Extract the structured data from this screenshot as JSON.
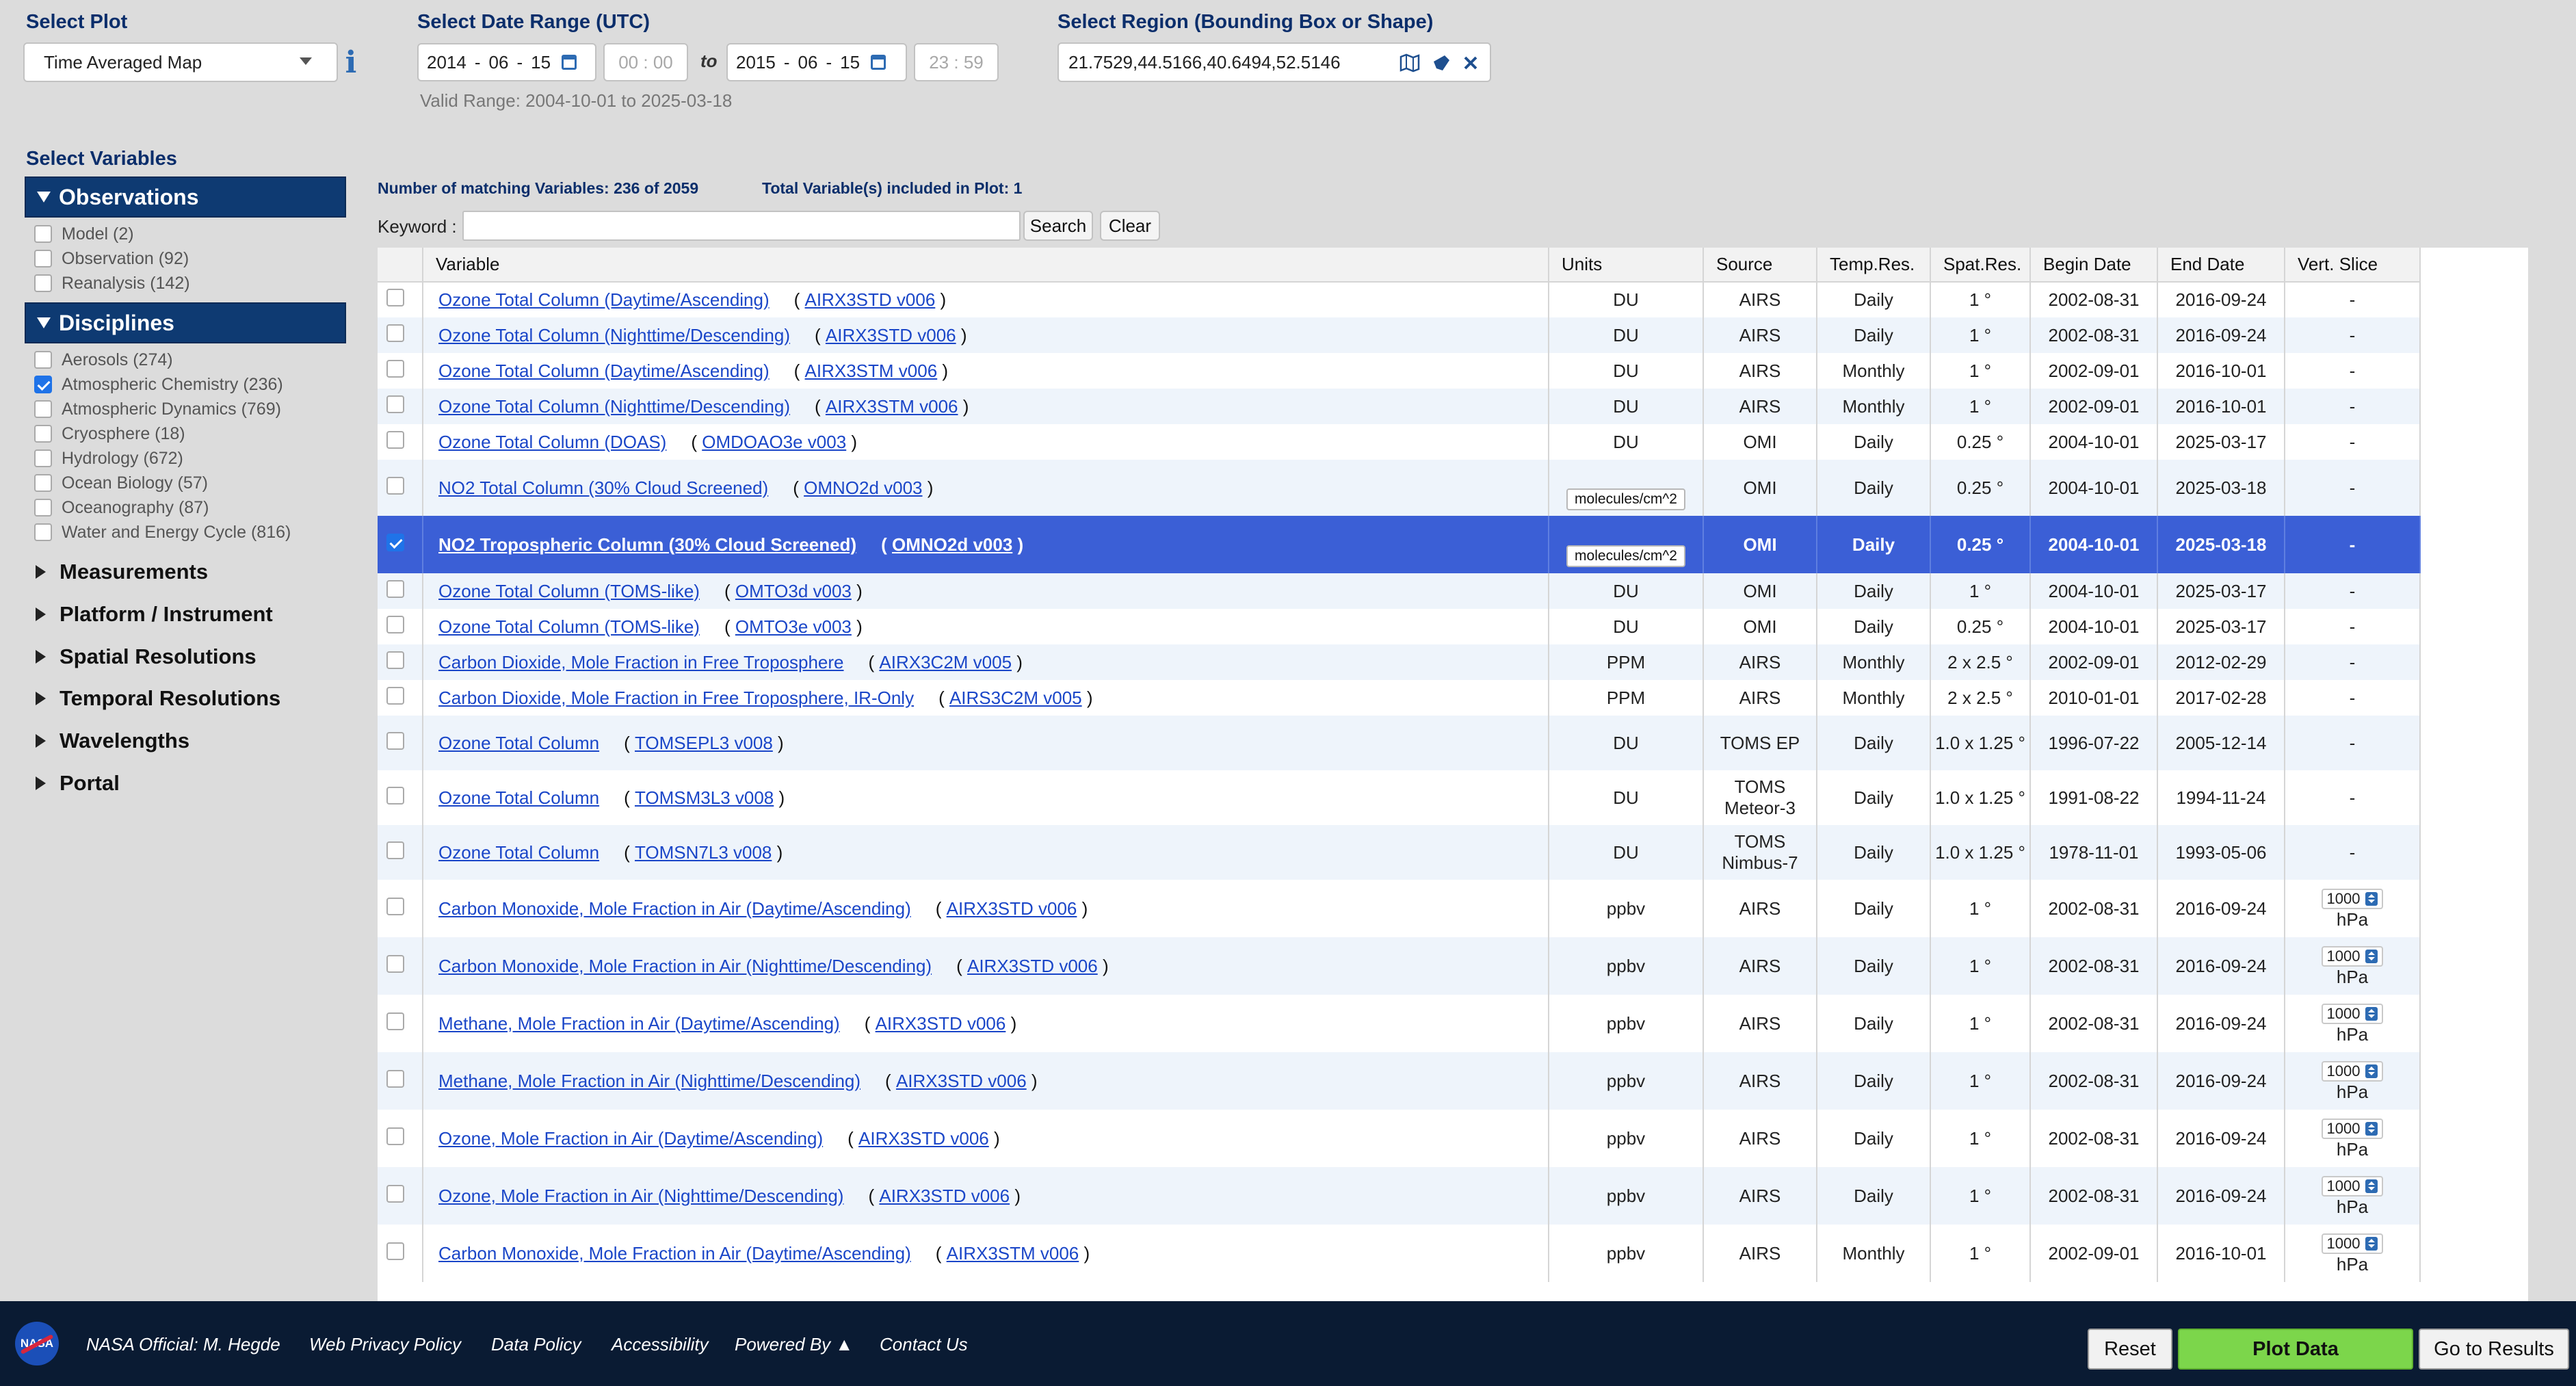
{
  "header": {
    "select_plot_label": "Select Plot",
    "plot_type": "Time Averaged Map",
    "info_glyph": "i",
    "date_range_label": "Select Date Range (UTC)",
    "start_year": "2014",
    "start_month": "06",
    "start_day": "15",
    "start_hour": "00",
    "start_min": "00",
    "to_label": "to",
    "end_year": "2015",
    "end_month": "06",
    "end_day": "15",
    "end_hour": "23",
    "end_min": "59",
    "valid_range": "Valid Range: 2004-10-01 to 2025-03-18",
    "region_label": "Select Region (Bounding Box or Shape)",
    "region_value": "21.7529,44.5166,40.6494,52.5146",
    "sep_dash": "-",
    "sep_colon": ":"
  },
  "sidebar": {
    "title": "Select Variables",
    "observations": {
      "label": "Observations",
      "items": [
        {
          "label": "Model (2)",
          "checked": false
        },
        {
          "label": "Observation (92)",
          "checked": false
        },
        {
          "label": "Reanalysis (142)",
          "checked": false
        }
      ]
    },
    "disciplines": {
      "label": "Disciplines",
      "items": [
        {
          "label": "Aerosols (274)",
          "checked": false
        },
        {
          "label": "Atmospheric Chemistry (236)",
          "checked": true
        },
        {
          "label": "Atmospheric Dynamics (769)",
          "checked": false
        },
        {
          "label": "Cryosphere (18)",
          "checked": false
        },
        {
          "label": "Hydrology (672)",
          "checked": false
        },
        {
          "label": "Ocean Biology (57)",
          "checked": false
        },
        {
          "label": "Oceanography (87)",
          "checked": false
        },
        {
          "label": "Water and Energy Cycle (816)",
          "checked": false
        }
      ]
    },
    "collapsed": [
      "Measurements",
      "Platform / Instrument",
      "Spatial Resolutions",
      "Temporal Resolutions",
      "Wavelengths",
      "Portal"
    ]
  },
  "results": {
    "matching": "Number of matching Variables: 236 of 2059",
    "included": "Total Variable(s) included in Plot: 1",
    "keyword_label": "Keyword :",
    "keyword_value": "",
    "search_label": "Search",
    "clear_label": "Clear",
    "columns": [
      "Variable",
      "Units",
      "Source",
      "Temp.Res.",
      "Spat.Res.",
      "Begin Date",
      "End Date",
      "Vert. Slice"
    ],
    "rows": [
      {
        "name": "Ozone Total Column (Daytime/Ascending)",
        "product": "AIRX3STD v006",
        "units": "DU",
        "source": "AIRS",
        "temp": "Daily",
        "spat": "1 °",
        "begin": "2002-08-31",
        "end": "2016-09-24",
        "vslice": "-",
        "checked": false
      },
      {
        "name": "Ozone Total Column (Nighttime/Descending)",
        "product": "AIRX3STD v006",
        "units": "DU",
        "source": "AIRS",
        "temp": "Daily",
        "spat": "1 °",
        "begin": "2002-08-31",
        "end": "2016-09-24",
        "vslice": "-",
        "checked": false
      },
      {
        "name": "Ozone Total Column (Daytime/Ascending)",
        "product": "AIRX3STM v006",
        "units": "DU",
        "source": "AIRS",
        "temp": "Monthly",
        "spat": "1 °",
        "begin": "2002-09-01",
        "end": "2016-10-01",
        "vslice": "-",
        "checked": false
      },
      {
        "name": "Ozone Total Column (Nighttime/Descending)",
        "product": "AIRX3STM v006",
        "units": "DU",
        "source": "AIRS",
        "temp": "Monthly",
        "spat": "1 °",
        "begin": "2002-09-01",
        "end": "2016-10-01",
        "vslice": "-",
        "checked": false
      },
      {
        "name": "Ozone Total Column (DOAS)",
        "product": "OMDOAO3e v003",
        "units": "DU",
        "source": "OMI",
        "temp": "Daily",
        "spat": "0.25 °",
        "begin": "2004-10-01",
        "end": "2025-03-17",
        "vslice": "-",
        "checked": false
      },
      {
        "name": "NO2 Total Column (30% Cloud Screened)",
        "product": "OMNO2d v003",
        "units": "molecules/cm^2",
        "source": "OMI",
        "temp": "Daily",
        "spat": "0.25 °",
        "begin": "2004-10-01",
        "end": "2025-03-18",
        "vslice": "-",
        "checked": false
      },
      {
        "name": "NO2 Tropospheric Column (30% Cloud Screened)",
        "product": "OMNO2d v003",
        "units": "molecules/cm^2",
        "source": "OMI",
        "temp": "Daily",
        "spat": "0.25 °",
        "begin": "2004-10-01",
        "end": "2025-03-18",
        "vslice": "-",
        "checked": true
      },
      {
        "name": "Ozone Total Column (TOMS-like)",
        "product": "OMTO3d v003",
        "units": "DU",
        "source": "OMI",
        "temp": "Daily",
        "spat": "1 °",
        "begin": "2004-10-01",
        "end": "2025-03-17",
        "vslice": "-",
        "checked": false
      },
      {
        "name": "Ozone Total Column (TOMS-like)",
        "product": "OMTO3e v003",
        "units": "DU",
        "source": "OMI",
        "temp": "Daily",
        "spat": "0.25 °",
        "begin": "2004-10-01",
        "end": "2025-03-17",
        "vslice": "-",
        "checked": false
      },
      {
        "name": "Carbon Dioxide, Mole Fraction in Free Troposphere",
        "product": "AIRX3C2M v005",
        "units": "PPM",
        "source": "AIRS",
        "temp": "Monthly",
        "spat": "2 x 2.5 °",
        "begin": "2002-09-01",
        "end": "2012-02-29",
        "vslice": "-",
        "checked": false
      },
      {
        "name": "Carbon Dioxide, Mole Fraction in Free Troposphere, IR-Only",
        "product": "AIRS3C2M v005",
        "units": "PPM",
        "source": "AIRS",
        "temp": "Monthly",
        "spat": "2 x 2.5 °",
        "begin": "2010-01-01",
        "end": "2017-02-28",
        "vslice": "-",
        "checked": false
      },
      {
        "name": "Ozone Total Column",
        "product": "TOMSEPL3 v008",
        "units": "DU",
        "source": "TOMS EP",
        "temp": "Daily",
        "spat": "1.0 x 1.25 °",
        "begin": "1996-07-22",
        "end": "2005-12-14",
        "vslice": "-",
        "checked": false
      },
      {
        "name": "Ozone Total Column",
        "product": "TOMSM3L3 v008",
        "units": "DU",
        "source": "TOMS Meteor-3",
        "temp": "Daily",
        "spat": "1.0 x 1.25 °",
        "begin": "1991-08-22",
        "end": "1994-11-24",
        "vslice": "-",
        "checked": false
      },
      {
        "name": "Ozone Total Column",
        "product": "TOMSN7L3 v008",
        "units": "DU",
        "source": "TOMS Nimbus-7",
        "temp": "Daily",
        "spat": "1.0 x 1.25 °",
        "begin": "1978-11-01",
        "end": "1993-05-06",
        "vslice": "-",
        "checked": false
      },
      {
        "name": "Carbon Monoxide, Mole Fraction in Air (Daytime/Ascending)",
        "product": "AIRX3STD v006",
        "units": "ppbv",
        "source": "AIRS",
        "temp": "Daily",
        "spat": "1 °",
        "begin": "2002-08-31",
        "end": "2016-09-24",
        "vslice": "1000",
        "vunit": "hPa",
        "checked": false
      },
      {
        "name": "Carbon Monoxide, Mole Fraction in Air (Nighttime/Descending)",
        "product": "AIRX3STD v006",
        "units": "ppbv",
        "source": "AIRS",
        "temp": "Daily",
        "spat": "1 °",
        "begin": "2002-08-31",
        "end": "2016-09-24",
        "vslice": "1000",
        "vunit": "hPa",
        "checked": false
      },
      {
        "name": "Methane, Mole Fraction in Air (Daytime/Ascending)",
        "product": "AIRX3STD v006",
        "units": "ppbv",
        "source": "AIRS",
        "temp": "Daily",
        "spat": "1 °",
        "begin": "2002-08-31",
        "end": "2016-09-24",
        "vslice": "1000",
        "vunit": "hPa",
        "checked": false
      },
      {
        "name": "Methane, Mole Fraction in Air (Nighttime/Descending)",
        "product": "AIRX3STD v006",
        "units": "ppbv",
        "source": "AIRS",
        "temp": "Daily",
        "spat": "1 °",
        "begin": "2002-08-31",
        "end": "2016-09-24",
        "vslice": "1000",
        "vunit": "hPa",
        "checked": false
      },
      {
        "name": "Ozone, Mole Fraction in Air (Daytime/Ascending)",
        "product": "AIRX3STD v006",
        "units": "ppbv",
        "source": "AIRS",
        "temp": "Daily",
        "spat": "1 °",
        "begin": "2002-08-31",
        "end": "2016-09-24",
        "vslice": "1000",
        "vunit": "hPa",
        "checked": false
      },
      {
        "name": "Ozone, Mole Fraction in Air (Nighttime/Descending)",
        "product": "AIRX3STD v006",
        "units": "ppbv",
        "source": "AIRS",
        "temp": "Daily",
        "spat": "1 °",
        "begin": "2002-08-31",
        "end": "2016-09-24",
        "vslice": "1000",
        "vunit": "hPa",
        "checked": false
      },
      {
        "name": "Carbon Monoxide, Mole Fraction in Air (Daytime/Ascending)",
        "product": "AIRX3STM v006",
        "units": "ppbv",
        "source": "AIRS",
        "temp": "Monthly",
        "spat": "1 °",
        "begin": "2002-09-01",
        "end": "2016-10-01",
        "vslice": "1000",
        "vunit": "hPa",
        "checked": false
      }
    ]
  },
  "footer": {
    "logo_text": "NASA",
    "links": [
      "NASA Official: M. Hegde",
      "Web Privacy Policy",
      "Data Policy",
      "Accessibility",
      "Powered By ▲",
      "Contact Us"
    ],
    "reset_label": "Reset",
    "plot_label": "Plot Data",
    "results_label": "Go to Results"
  },
  "colors": {
    "facet_header": "#0e3a72",
    "selected_row": "#3b5fd6",
    "plot_button": "#7cd64b",
    "footer_bg": "#0a1b33",
    "link": "#1a46c8"
  },
  "icons": [
    "info-icon",
    "calendar-icon",
    "map-icon",
    "shape-icon",
    "clear-region-icon",
    "nasa-logo-icon",
    "spinner-icon"
  ]
}
